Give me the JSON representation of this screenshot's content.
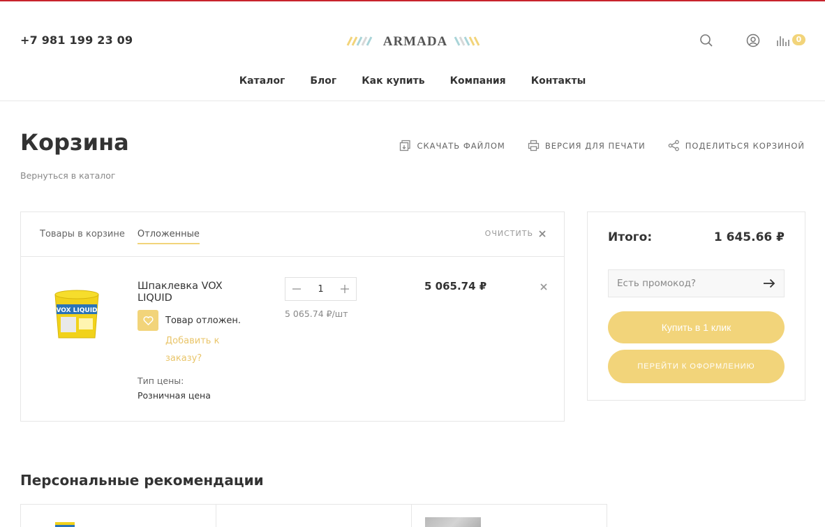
{
  "header": {
    "phone": "+7 981 199 23 09",
    "logo_text": "ARMADA",
    "cart_count": "0",
    "icons": [
      "search-icon",
      "user-icon",
      "compare-icon"
    ]
  },
  "nav": {
    "items": [
      "Каталог",
      "Блог",
      "Как купить",
      "Компания",
      "Контакты"
    ]
  },
  "page": {
    "title": "Корзина",
    "back_link": "Вернуться в каталог",
    "actions": {
      "download": "Скачать файлом",
      "print": "Версия для печати",
      "share": "Поделиться корзиной"
    }
  },
  "cart": {
    "tabs": [
      "Товары в корзине",
      "Отложенные"
    ],
    "active_tab": "Отложенные",
    "clear_label": "ОЧИСТИТЬ",
    "item": {
      "name": "Шпаклевка VOX LIQUID",
      "deferred_text": "Товар отложен.",
      "add_link": "Добавить к заказу?",
      "price_type_label": "Тип цены:",
      "price_type_value": "Розничная цена",
      "quantity": "1",
      "unit_price": "5 065.74 ₽/шт",
      "total_price": "5 065.74 ₽"
    }
  },
  "summary": {
    "total_label": "Итого:",
    "total_value": "1 645.66 ₽",
    "promo_placeholder": "Есть промокод?",
    "one_click_label": "Купить в 1 клик",
    "checkout_label": "Перейти к оформлению"
  },
  "recommendations": {
    "title": "Персональные рекомендации"
  },
  "colors": {
    "accent": "#f2d47a",
    "topline": "#c8232c",
    "link": "#e9c56a"
  }
}
